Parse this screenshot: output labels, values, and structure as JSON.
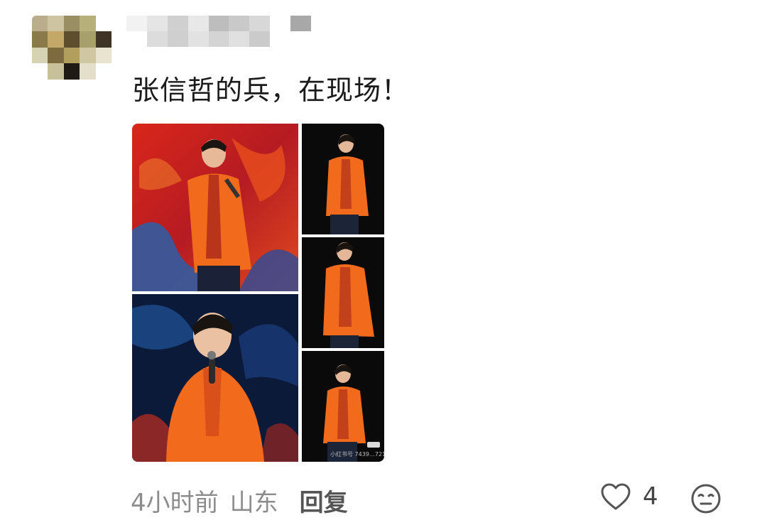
{
  "comment": {
    "text": "张信哲的兵，在现场！",
    "time": "4小时前",
    "location": "山东",
    "reply_label": "回复",
    "like_count": "4"
  },
  "gallery": {
    "image_count": 5,
    "watermark_text": "小红书号 7439…721"
  },
  "colors": {
    "background": "#ffffff",
    "text": "#1a1a1a",
    "meta": "#8c8c8c",
    "outfit_orange": "#f26a1b"
  },
  "icons": {
    "like": "heart-outline-icon",
    "emoji": "neutral-face-icon"
  }
}
